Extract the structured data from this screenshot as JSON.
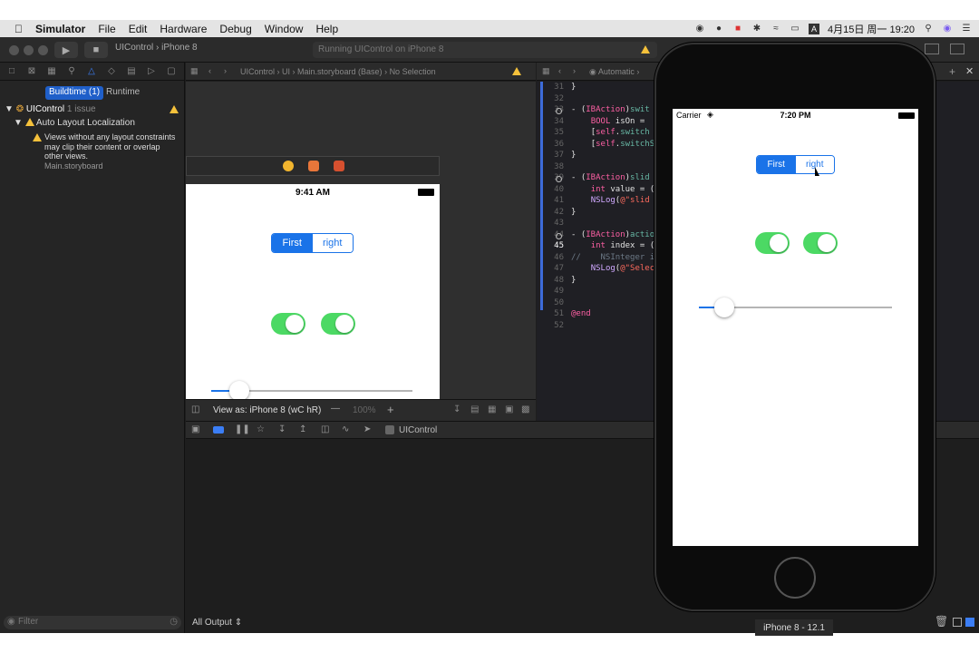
{
  "menubar": {
    "app_name": "Simulator",
    "items": [
      "File",
      "Edit",
      "Hardware",
      "Debug",
      "Window",
      "Help"
    ],
    "clock": "4月15日 周一  19:20"
  },
  "toolbar": {
    "scheme": "UIControl",
    "device": "iPhone 8",
    "activity": "Running UIControl on iPhone 8"
  },
  "navigator": {
    "seg_buildtime": "Buildtime (1)",
    "seg_runtime": "Runtime",
    "project": "UIControl",
    "issue_count": "1 issue",
    "group": "Auto Layout Localization",
    "issue_lines": [
      "Views without any layout constraints",
      "may clip their content or overlap",
      "other views."
    ],
    "issue_file": "Main.storyboard",
    "filter_placeholder": "Filter"
  },
  "ib": {
    "breadcrumb": [
      "UIControl",
      "UI",
      "Main.storyboard (Base)",
      "No Selection"
    ],
    "status_time": "9:41 AM",
    "segment_labels": [
      "First",
      "right"
    ],
    "view_as": "View as: iPhone 8 (",
    "view_as_traits": "wC hR)",
    "zoom": "100%"
  },
  "debug": {
    "process": "UIControl",
    "output_selector": "All Output"
  },
  "code": {
    "bar_label": "Automatic",
    "lines": [
      {
        "n": "31",
        "text": "}"
      },
      {
        "n": "32",
        "text": ""
      },
      {
        "n": "33",
        "text": "- (IBAction)swit",
        "bp": true
      },
      {
        "n": "34",
        "text": "    BOOL isOn = "
      },
      {
        "n": "35",
        "text": "    [self.switch"
      },
      {
        "n": "36",
        "text": "    [self.switchS"
      },
      {
        "n": "37",
        "text": "}"
      },
      {
        "n": "38",
        "text": ""
      },
      {
        "n": "39",
        "text": "- (IBAction)slid",
        "bp": true
      },
      {
        "n": "40",
        "text": "    int value = ("
      },
      {
        "n": "41",
        "text": "    NSLog(@\"slid"
      },
      {
        "n": "42",
        "text": "}"
      },
      {
        "n": "43",
        "text": ""
      },
      {
        "n": "44",
        "text": "- (IBAction)actio",
        "bp": true
      },
      {
        "n": "45",
        "text": "    int index = (",
        "current": true
      },
      {
        "n": "46",
        "text": "//    NSInteger i"
      },
      {
        "n": "47",
        "text": "    NSLog(@\"Selec"
      },
      {
        "n": "48",
        "text": "}"
      },
      {
        "n": "49",
        "text": ""
      },
      {
        "n": "50",
        "text": ""
      },
      {
        "n": "51",
        "text": "@end"
      },
      {
        "n": "52",
        "text": ""
      }
    ]
  },
  "simulator": {
    "carrier": "Carrier",
    "time": "7:20 PM",
    "segment_labels": [
      "First",
      "right"
    ],
    "selected_segment": 0,
    "switch_states": [
      true,
      true
    ],
    "slider_value": 0.13,
    "device_label": "iPhone 8 - 12.1"
  },
  "colors": {
    "accent": "#1a73e8",
    "switch_on": "#4cd964",
    "warning": "#f5c13b"
  }
}
